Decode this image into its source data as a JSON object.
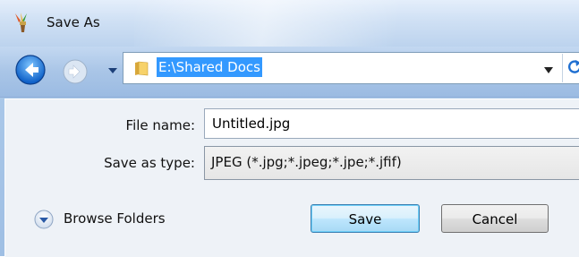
{
  "window": {
    "title": "Save As"
  },
  "address": {
    "path": "E:\\Shared Docs"
  },
  "form": {
    "file_name_label": "File name:",
    "file_name_value": "Untitled.jpg",
    "save_type_label": "Save as type:",
    "save_type_value": "JPEG (*.jpg;*.jpeg;*.jpe;*.jfif)"
  },
  "footer": {
    "browse_label": "Browse Folders",
    "save_label": "Save",
    "cancel_label": "Cancel"
  },
  "icons": {
    "app": "paintbrush-icon",
    "back": "back-arrow-icon",
    "forward": "forward-arrow-icon",
    "folder": "folder-icon",
    "refresh": "refresh-icon",
    "browse": "expand-chevron-icon"
  },
  "colors": {
    "selection": "#3399ff",
    "accent": "#3c7fb1"
  }
}
